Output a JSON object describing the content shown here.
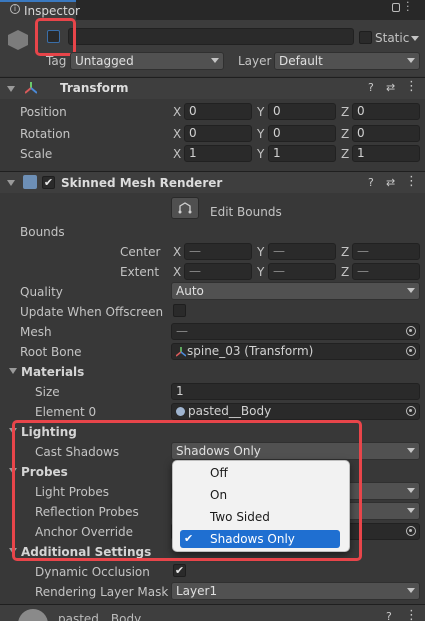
{
  "tab": {
    "title": "Inspector"
  },
  "object": {
    "name": "",
    "static_label": "Static",
    "tag_label": "Tag",
    "tag_value": "Untagged",
    "layer_label": "Layer",
    "layer_value": "Default"
  },
  "transform": {
    "title": "Transform",
    "position": {
      "label": "Position",
      "x": "0",
      "y": "0",
      "z": "0"
    },
    "rotation": {
      "label": "Rotation",
      "x": "0",
      "y": "0",
      "z": "0"
    },
    "scale": {
      "label": "Scale",
      "x": "1",
      "y": "1",
      "z": "1"
    },
    "axis": {
      "x": "X",
      "y": "Y",
      "z": "Z"
    }
  },
  "smr": {
    "title": "Skinned Mesh Renderer",
    "edit_bounds": "Edit Bounds",
    "bounds_label": "Bounds",
    "center_label": "Center",
    "extent_label": "Extent",
    "dash": "—",
    "quality_label": "Quality",
    "quality_value": "Auto",
    "update_offscreen_label": "Update When Offscreen",
    "mesh_label": "Mesh",
    "mesh_value": "—",
    "root_bone_label": "Root Bone",
    "root_bone_value": "spine_03 (Transform)",
    "materials_label": "Materials",
    "size_label": "Size",
    "size_value": "1",
    "element0_label": "Element 0",
    "element0_value": "pasted__Body",
    "lighting_label": "Lighting",
    "cast_shadows_label": "Cast Shadows",
    "cast_shadows_value": "Shadows Only",
    "probes_label": "Probes",
    "light_probes_label": "Light Probes",
    "reflection_probes_label": "Reflection Probes",
    "anchor_override_label": "Anchor Override",
    "additional_label": "Additional Settings",
    "dynamic_occlusion_label": "Dynamic Occlusion",
    "rendering_layer_label": "Rendering Layer Mask",
    "rendering_layer_value": "Layer1"
  },
  "popup": {
    "options": [
      "Off",
      "On",
      "Two Sided",
      "Shadows Only"
    ],
    "selected": "Shadows Only",
    "check": "✔"
  },
  "footer": {
    "material_name": "pasted__Body"
  },
  "colors": {
    "accent": "#1f6fd1",
    "highlight": "#e8454a"
  }
}
